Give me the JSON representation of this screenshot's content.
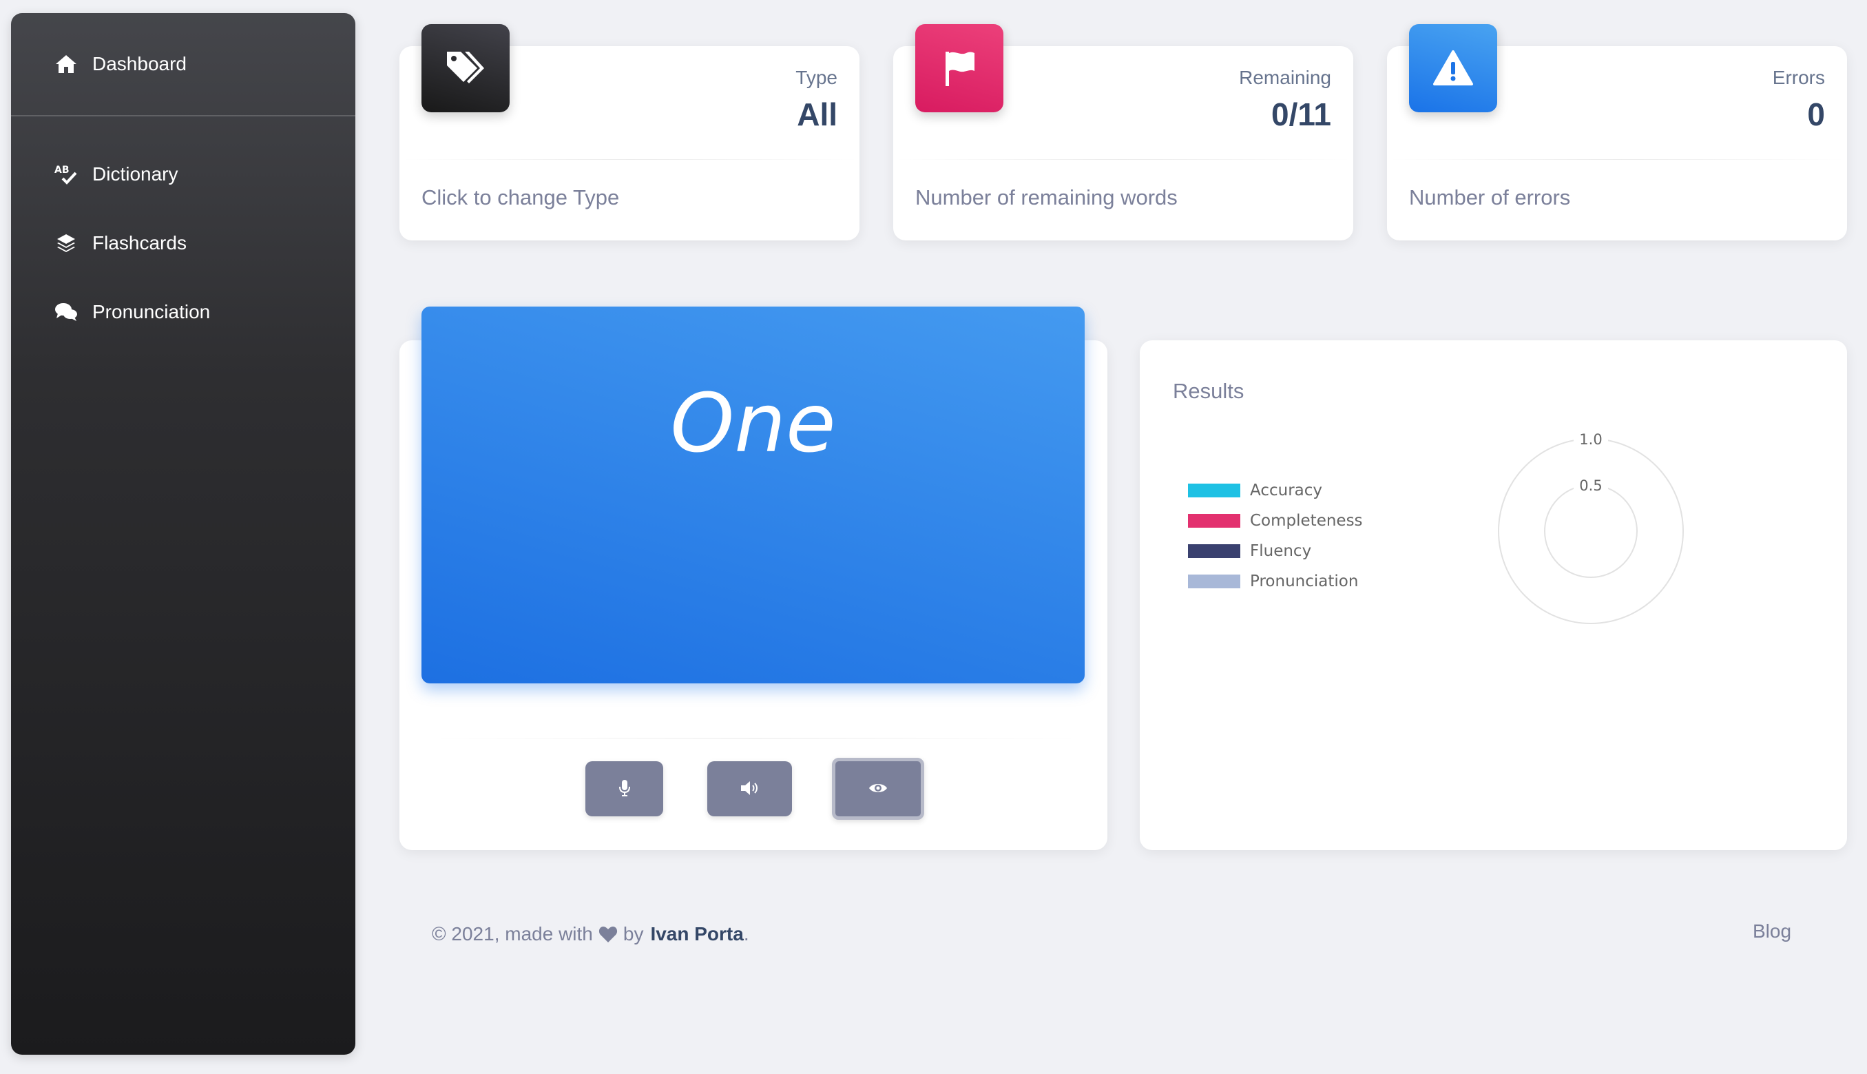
{
  "sidebar": {
    "brand": {
      "label": "Dashboard",
      "icon": "home-icon"
    },
    "items": [
      {
        "label": "Dictionary",
        "icon": "spellcheck-icon"
      },
      {
        "label": "Flashcards",
        "icon": "layers-icon"
      },
      {
        "label": "Pronunciation",
        "icon": "comments-icon"
      }
    ]
  },
  "stats": [
    {
      "label": "Type",
      "value": "All",
      "footer": "Click to change Type",
      "icon": "tags-icon",
      "color": "#212121"
    },
    {
      "label": "Remaining",
      "value": "0/11",
      "footer": "Number of remaining words",
      "icon": "flag-icon",
      "color": "#e91e63"
    },
    {
      "label": "Errors",
      "value": "0",
      "footer": "Number of errors",
      "icon": "warning-icon",
      "color": "#1a73e8"
    }
  ],
  "flashcard": {
    "word": "One",
    "controls": [
      {
        "icon": "microphone-icon"
      },
      {
        "icon": "speaker-icon"
      },
      {
        "icon": "eye-icon"
      }
    ]
  },
  "results": {
    "title": "Results",
    "chart_data": {
      "type": "radar",
      "series": [
        {
          "name": "Accuracy",
          "color": "#1ec1e4",
          "values": []
        },
        {
          "name": "Completeness",
          "color": "#e3316f",
          "values": []
        },
        {
          "name": "Fluency",
          "color": "#3a416f",
          "values": []
        },
        {
          "name": "Pronunciation",
          "color": "#a8b8d8",
          "values": []
        }
      ],
      "ticks": [
        "1.0",
        "0.5"
      ],
      "rlim": [
        0,
        1.0
      ],
      "legend": "left"
    }
  },
  "footer": {
    "copyright_prefix": "© 2021, made with",
    "by": "by",
    "author": "Ivan Porta",
    "suffix": ".",
    "link": "Blog"
  }
}
